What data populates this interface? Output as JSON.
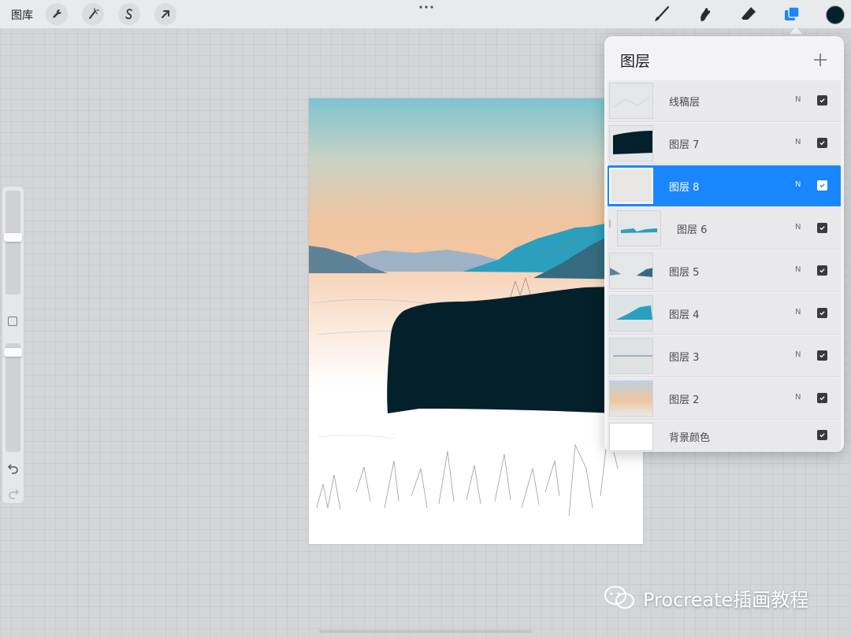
{
  "toolbar": {
    "gallery_label": "图库",
    "left_tools": [
      "wrench-icon",
      "magic-wand-icon",
      "selection-icon",
      "transform-arrow-icon"
    ],
    "right_tools": [
      "brush-icon",
      "smudge-icon",
      "eraser-icon",
      "layers-icon"
    ],
    "current_color": "#062129",
    "active_tool": "layers"
  },
  "layers_panel": {
    "title": "图层",
    "add_icon": "plus-icon",
    "accent_color": "#1a86ff",
    "layers": [
      {
        "name": "线稿层",
        "mode": "N",
        "visible": true,
        "active": false,
        "clipped": false
      },
      {
        "name": "图层 7",
        "mode": "N",
        "visible": true,
        "active": false,
        "clipped": false
      },
      {
        "name": "图层 8",
        "mode": "N",
        "visible": true,
        "active": true,
        "clipped": false
      },
      {
        "name": "图层 6",
        "mode": "N",
        "visible": true,
        "active": false,
        "clipped": true
      },
      {
        "name": "图层 5",
        "mode": "N",
        "visible": true,
        "active": false,
        "clipped": false
      },
      {
        "name": "图层 4",
        "mode": "N",
        "visible": true,
        "active": false,
        "clipped": false
      },
      {
        "name": "图层 3",
        "mode": "N",
        "visible": true,
        "active": false,
        "clipped": false
      },
      {
        "name": "图层 2",
        "mode": "N",
        "visible": true,
        "active": false,
        "clipped": false
      },
      {
        "name": "背景颜色",
        "mode": "",
        "visible": true,
        "active": false,
        "clipped": false
      }
    ]
  },
  "sidebar": {
    "brush_size_level": 0.35,
    "opacity_level": 0.95,
    "undo_icon": "undo-icon",
    "redo_icon": "redo-icon"
  },
  "watermark": {
    "text": "Procreate插画教程",
    "icon": "wechat-icon"
  }
}
